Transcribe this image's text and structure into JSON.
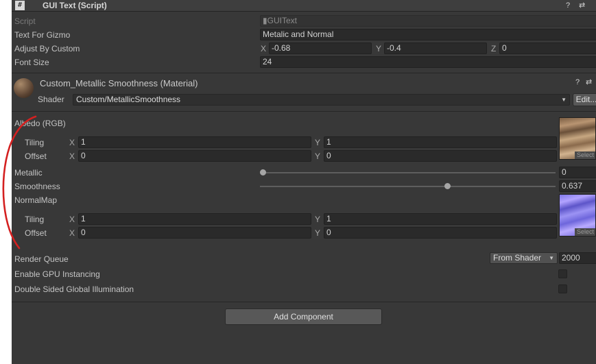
{
  "component": {
    "title": "GUI Text (Script)",
    "icon_glyph": "#",
    "help_icon": "?",
    "settings_icon": "⇄",
    "script_label": "Script",
    "script_value": "GUIText",
    "text_for_gizmo_label": "Text For Gizmo",
    "text_for_gizmo_value": "Metalic and Normal",
    "adjust_label": "Adjust By Custom",
    "adjust": {
      "x_label": "X",
      "x": "-0.68",
      "y_label": "Y",
      "y": "-0.4",
      "z_label": "Z",
      "z": "0"
    },
    "font_size_label": "Font Size",
    "font_size_value": "24"
  },
  "material": {
    "title": "Custom_Metallic Smoothness (Material)",
    "help_icon": "?",
    "settings_icon": "⇄",
    "shader_label": "Shader",
    "shader_value": "Custom/MetallicSmoothness",
    "edit_label": "Edit..."
  },
  "albedo": {
    "label": "Albedo (RGB)",
    "select_label": "Select",
    "tiling_label": "Tiling",
    "tiling_x": "1",
    "tiling_y": "1",
    "offset_label": "Offset",
    "offset_x": "0",
    "offset_y": "0",
    "x_label": "X",
    "y_label": "Y"
  },
  "metallic": {
    "label": "Metallic",
    "value": "0",
    "fraction": 0.0
  },
  "smoothness": {
    "label": "Smoothness",
    "value": "0.637",
    "fraction": 0.637
  },
  "normalmap": {
    "label": "NormalMap",
    "select_label": "Select",
    "tiling_label": "Tiling",
    "tiling_x": "1",
    "tiling_y": "1",
    "offset_label": "Offset",
    "offset_x": "0",
    "offset_y": "0",
    "x_label": "X",
    "y_label": "Y"
  },
  "render_queue": {
    "label": "Render Queue",
    "mode": "From Shader",
    "value": "2000"
  },
  "gpu_instancing": {
    "label": "Enable GPU Instancing",
    "checked": false
  },
  "double_sided_gi": {
    "label": "Double Sided Global Illumination",
    "checked": false
  },
  "add_component_label": "Add Component",
  "colors": {
    "panel_bg": "#383838",
    "annotation": "#d42020",
    "header_bg": "#3e3e3e"
  }
}
